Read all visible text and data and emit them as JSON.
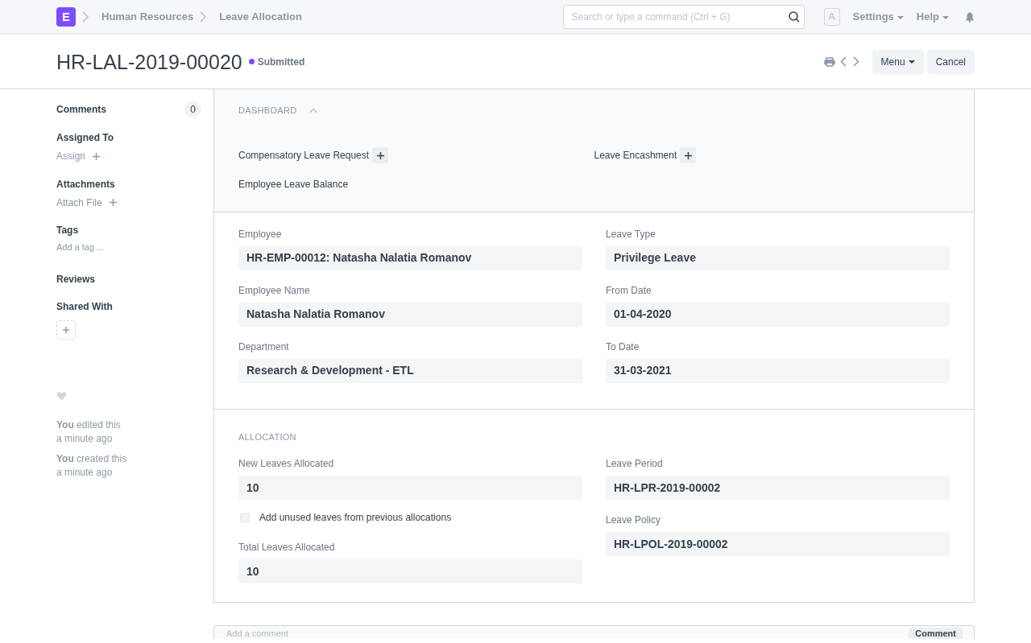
{
  "navbar": {
    "logo_letter": "E",
    "breadcrumbs": [
      "Human Resources",
      "Leave Allocation"
    ],
    "search": {
      "placeholder": "Search or type a command (Ctrl + G)"
    },
    "avatar": "A",
    "menus": [
      "Settings",
      "Help"
    ]
  },
  "header": {
    "title": "HR-LAL-2019-00020",
    "status": {
      "label": "Submitted",
      "color": "#7c4dff"
    },
    "buttons": [
      {
        "label": "Menu",
        "dropdown": true
      },
      {
        "label": "Cancel",
        "dropdown": false
      }
    ]
  },
  "sidebar": {
    "comments": {
      "label": "Comments",
      "count": "0"
    },
    "sections": [
      {
        "title": "Assigned To",
        "action": "Assign",
        "kind": "add"
      },
      {
        "title": "Attachments",
        "action": "Attach File",
        "kind": "add"
      },
      {
        "title": "Tags",
        "action": "Add a tag ...",
        "kind": "tag"
      },
      {
        "title": "Reviews",
        "kind": "plain"
      },
      {
        "title": "Shared With",
        "kind": "share"
      }
    ],
    "activity": [
      {
        "actor": "You",
        "action": "edited this",
        "time": "a minute ago"
      },
      {
        "actor": "You",
        "action": "created this",
        "time": "a minute ago"
      }
    ]
  },
  "dashboard": {
    "title": "DASHBOARD",
    "expanded": true,
    "links": [
      {
        "label": "Compensatory Leave Request",
        "addable": true
      },
      {
        "label": "Leave Encashment",
        "addable": true
      },
      {
        "label": "Employee Leave Balance",
        "addable": false
      }
    ]
  },
  "details": {
    "left": [
      {
        "kind": "field",
        "label": "Employee",
        "value": "HR-EMP-00012: Natasha Nalatia Romanov"
      },
      {
        "kind": "field",
        "label": "Employee Name",
        "value": "Natasha Nalatia Romanov"
      },
      {
        "kind": "field",
        "label": "Department",
        "value": "Research & Development - ETL"
      }
    ],
    "right": [
      {
        "kind": "field",
        "label": "Leave Type",
        "value": "Privilege Leave"
      },
      {
        "kind": "field",
        "label": "From Date",
        "value": "01-04-2020"
      },
      {
        "kind": "field",
        "label": "To Date",
        "value": "31-03-2021"
      }
    ]
  },
  "allocation": {
    "title": "ALLOCATION",
    "left": [
      {
        "kind": "field",
        "label": "New Leaves Allocated",
        "value": "10"
      },
      {
        "kind": "checkbox",
        "label": "Add unused leaves from previous allocations",
        "checked": false
      },
      {
        "kind": "field",
        "label": "Total Leaves Allocated",
        "value": "10"
      }
    ],
    "right": [
      {
        "kind": "field",
        "label": "Leave Period",
        "value": "HR-LPR-2019-00002"
      },
      {
        "kind": "field",
        "label": "Leave Policy",
        "value": "HR-LPOL-2019-00002"
      }
    ]
  },
  "comment_box": {
    "placeholder": "Add a comment",
    "button": "Comment"
  }
}
